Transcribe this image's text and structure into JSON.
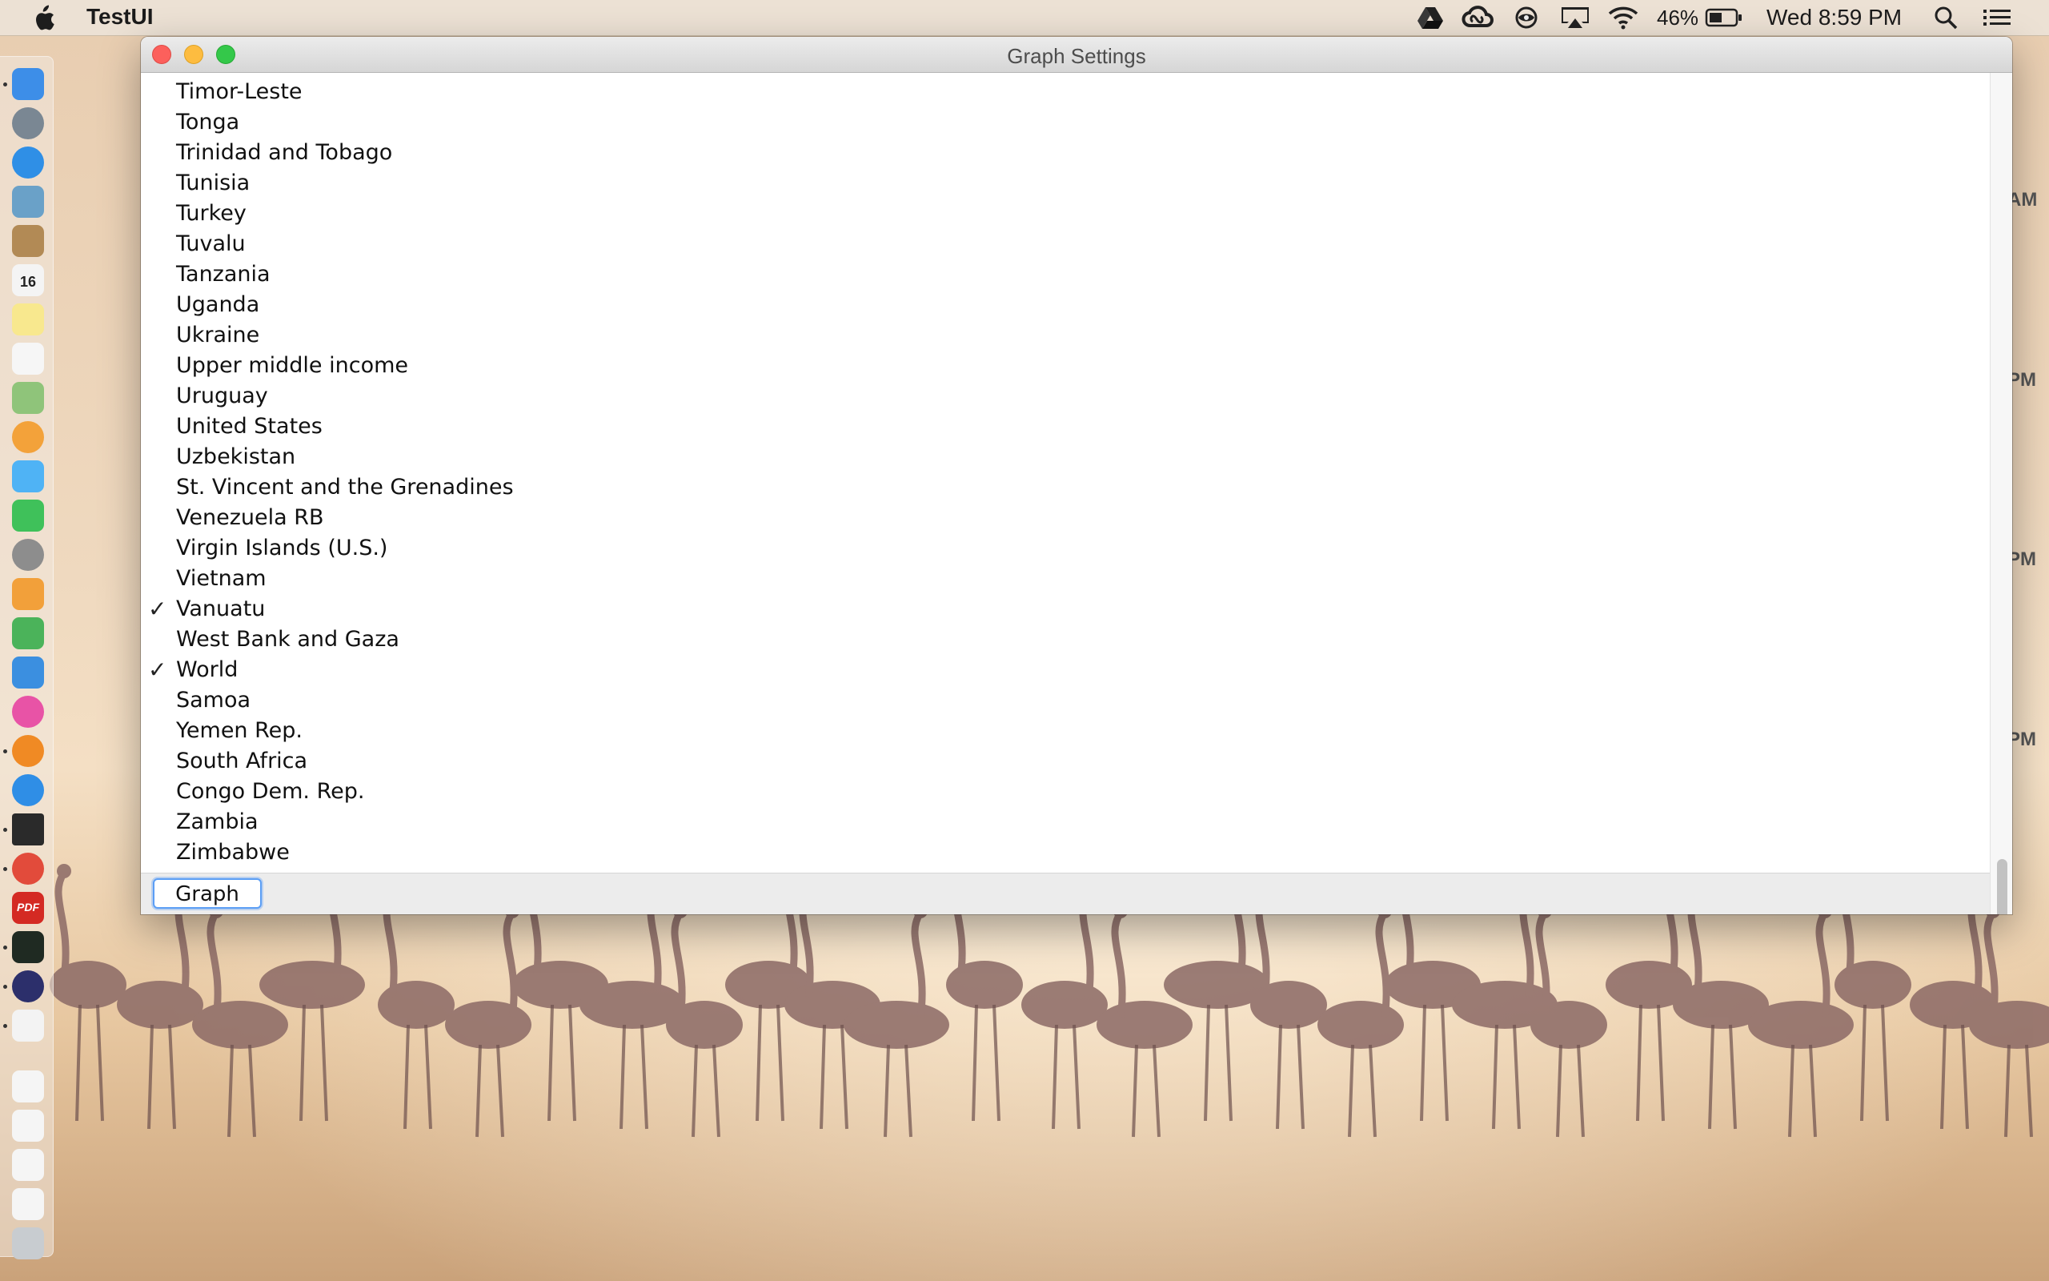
{
  "menubar": {
    "app_name": "TestUI",
    "battery_percent": "46%",
    "clock": "Wed 8:59 PM",
    "status_icons": [
      "google-drive-icon",
      "creative-cloud-icon",
      "eye-icon",
      "airplay-icon",
      "wifi-icon",
      "battery-icon",
      "spotlight-search-icon",
      "notification-center-icon"
    ]
  },
  "window": {
    "title": "Graph Settings",
    "list": [
      {
        "label": "Timor-Leste",
        "checked": false
      },
      {
        "label": "Tonga",
        "checked": false
      },
      {
        "label": "Trinidad and Tobago",
        "checked": false
      },
      {
        "label": "Tunisia",
        "checked": false
      },
      {
        "label": "Turkey",
        "checked": false
      },
      {
        "label": "Tuvalu",
        "checked": false
      },
      {
        "label": "Tanzania",
        "checked": false
      },
      {
        "label": "Uganda",
        "checked": false
      },
      {
        "label": "Ukraine",
        "checked": false
      },
      {
        "label": "Upper middle income",
        "checked": false
      },
      {
        "label": "Uruguay",
        "checked": false
      },
      {
        "label": "United States",
        "checked": false
      },
      {
        "label": "Uzbekistan",
        "checked": false
      },
      {
        "label": "St. Vincent and the Grenadines",
        "checked": false
      },
      {
        "label": "Venezuela RB",
        "checked": false
      },
      {
        "label": "Virgin Islands (U.S.)",
        "checked": false
      },
      {
        "label": "Vietnam",
        "checked": false
      },
      {
        "label": "Vanuatu",
        "checked": true
      },
      {
        "label": "West Bank and Gaza",
        "checked": false
      },
      {
        "label": "World",
        "checked": true
      },
      {
        "label": "Samoa",
        "checked": false
      },
      {
        "label": "Yemen Rep.",
        "checked": false
      },
      {
        "label": "South Africa",
        "checked": false
      },
      {
        "label": "Congo Dem. Rep.",
        "checked": false
      },
      {
        "label": "Zambia",
        "checked": false
      },
      {
        "label": "Zimbabwe",
        "checked": false
      }
    ],
    "checkmark": "✓",
    "graph_button": "Graph"
  },
  "dock": {
    "items": [
      "finder-icon",
      "launchpad-icon",
      "safari-icon",
      "preview-icon",
      "contacts-icon",
      "calendar-icon",
      "notes-icon",
      "reminders-icon",
      "maps-icon",
      "photos-icon",
      "messages-icon",
      "facetime-icon",
      "system-preferences-icon",
      "pages-icon",
      "numbers-icon",
      "keynote-icon",
      "itunes-icon",
      "ibooks-icon",
      "app-store-icon",
      "terminal-icon",
      "chrome-icon",
      "pdf-icon",
      "activity-monitor-icon",
      "eclipse-icon",
      "java-icon",
      "document-icon",
      "document-icon",
      "document-icon",
      "document-icon",
      "trash-icon"
    ],
    "calendar_day": "16",
    "pdf_label": "PDF"
  },
  "background_edge_text": [
    "AM",
    "PM",
    "PM",
    "PM"
  ],
  "colors": {
    "accent": "#5b9ef5",
    "close": "#fc605c",
    "minimize": "#fdbc40",
    "maximize": "#34c84a"
  }
}
